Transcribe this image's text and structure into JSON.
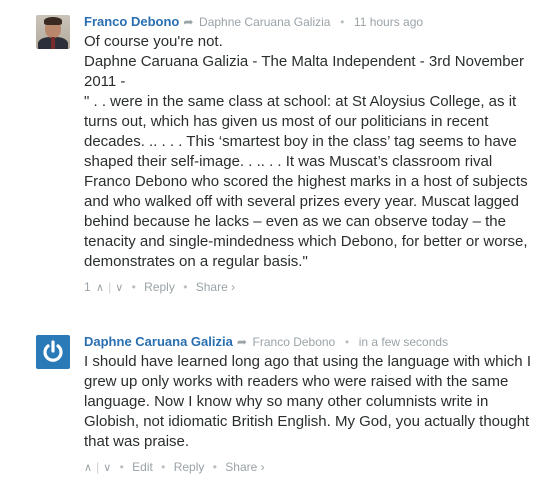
{
  "comments": [
    {
      "author": "Franco Debono",
      "reply_to": "Daphne Caruana Galizia",
      "time": "11 hours ago",
      "paragraphs": [
        "Of course you're not.",
        "Daphne Caruana Galizia - The Malta Independent - 3rd November 2011 -",
        "\" . . were in the same class at school: at St Aloysius College, as it turns out, which has given us most of our politicians in recent decades. .. . . . This ‘smartest boy in the class’ tag seems to have shaped their self-image. . .. . . It was Muscat’s classroom rival Franco Debono who scored the highest marks in a host of subjects and who walked off with several prizes every year. Muscat lagged behind because he lacks – even as we can observe today – the tenacity and single-mindedness which Debono, for better or worse, demonstrates on a regular basis.\""
      ],
      "footer": {
        "upvotes": "1",
        "reply": "Reply",
        "share": "Share ›"
      }
    },
    {
      "author": "Daphne Caruana Galizia",
      "reply_to": "Franco Debono",
      "time": "in a few seconds",
      "paragraphs": [
        "I should have learned long ago that using the language with which I grew up only works with readers who were raised with the same language. Now I know why so many other columnists write in Globish, not idiomatic British English. My God, you actually thought that was praise."
      ],
      "footer": {
        "edit": "Edit",
        "reply": "Reply",
        "share": "Share ›"
      }
    }
  ],
  "icons": {
    "reply_arrow": "➦",
    "upvote": "⌃",
    "downvote": "⌄",
    "separator": "•"
  },
  "colors": {
    "author": "#2a6fb0",
    "meta": "#9aa3a8",
    "text": "#2a2e2e",
    "logo_bg": "#2a7ab8"
  }
}
